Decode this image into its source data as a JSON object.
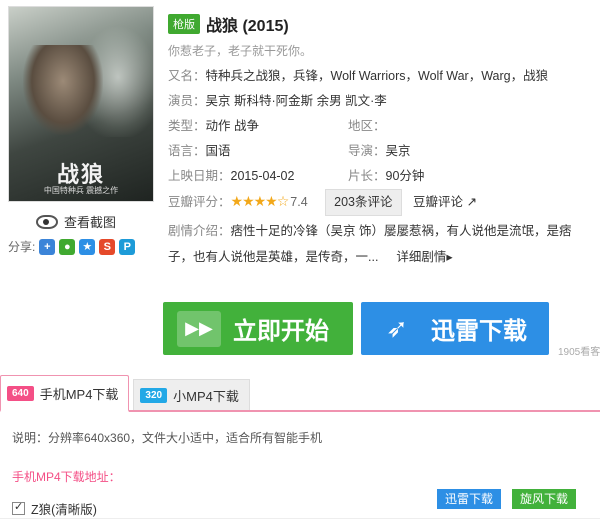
{
  "poster": {
    "title_text": "战狼",
    "subtitle_text": "中国特种兵 震撼之作"
  },
  "view_shots_label": "查看截图",
  "share_label": "分享:",
  "share_icons": [
    {
      "name": "tencent-weibo",
      "color": "#3b84d8",
      "glyph": "+"
    },
    {
      "name": "wechat",
      "color": "#40a930",
      "glyph": "●"
    },
    {
      "name": "qzone",
      "color": "#2d8fe5",
      "glyph": "★"
    },
    {
      "name": "sina-weibo",
      "color": "#e5492a",
      "glyph": "S"
    },
    {
      "name": "qq",
      "color": "#1d9bd8",
      "glyph": "P"
    }
  ],
  "movie": {
    "tag": "枪版",
    "title": "战狼 (2015)",
    "tagline": "你惹老子，老子就干死你。",
    "aka_label": "又名：",
    "aka_value": "特种兵之战狼，兵锋，Wolf Warriors，Wolf War，Warg，战狼",
    "cast_label": "演员：",
    "cast_value": "吴京  斯科特·阿金斯  余男  凯文·李",
    "genre_label": "类型：",
    "genre_value": "动作 战争",
    "region_label": "地区：",
    "region_value": "",
    "language_label": "语言：",
    "language_value": "国语",
    "director_label": "导演：",
    "director_value": "吴京",
    "release_label": "上映日期：",
    "release_value": "2015-04-02",
    "runtime_label": "片长：",
    "runtime_value": "90分钟",
    "rating_label": "豆瓣评分：",
    "rating_stars": "★★★★☆",
    "rating_value": "7.4",
    "reviews_button": "203条评论",
    "douban_link": "豆瓣评论",
    "plot_label": "剧情介绍：",
    "plot_value": "痞性十足的冷锋（吴京 饰）屡屡惹祸，有人说他是流氓，是痞子，也有人说他是英雄，是传奇，一...",
    "more_link": "详细剧情▸"
  },
  "buttons": {
    "start_label": "立即开始",
    "thunder_label": "迅雷下载",
    "watch_count": "1905看客"
  },
  "download": {
    "tab_active_badge": "640",
    "tab_active_label": "手机MP4下载",
    "tab_inactive_badge": "320",
    "tab_inactive_label": "小MP4下载",
    "note": "说明：分辨率640x360，文件大小适中，适合所有智能手机",
    "address_label": "手机MP4下载地址：",
    "file_name": "Z狼(清晰版)",
    "file_checked": true,
    "thunder_btn": "迅雷下载",
    "whirl_btn": "旋风下载"
  }
}
